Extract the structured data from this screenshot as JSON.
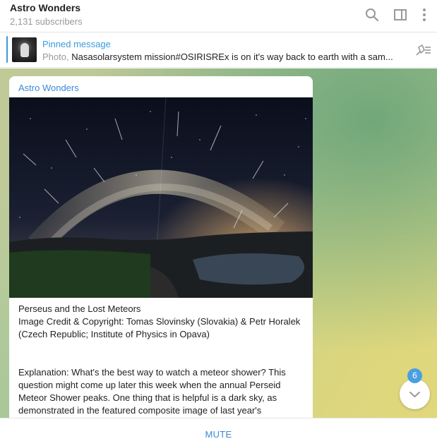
{
  "header": {
    "title": "Astro Wonders",
    "subtitle": "2,131 subscribers",
    "icons": [
      "search-icon",
      "sidebar-toggle-icon",
      "more-vertical-icon"
    ]
  },
  "pinned": {
    "label": "Pinned message",
    "type": "Photo,",
    "text": "Nasasolarsystem mission#OSIRISREx is on it's way back to earth with a sam...",
    "icons": [
      "pinned-thumbnail",
      "unpin-icon"
    ]
  },
  "message": {
    "channel": "Astro Wonders",
    "caption_lines": [
      "Perseus and the Lost Meteors",
      "Image Credit & Copyright: Tomas Slovinsky (Slovakia) & Petr Horalek (Czech Republic; Institute of Physics in Opava)"
    ],
    "explanation": "Explanation: What's the best way to watch a meteor shower? This question might come up later this week when the annual Perseid Meteor Shower peaks. One thing that is helpful is a dark sky, as demonstrated in the featured composite image of last year's"
  },
  "unread_count": "6",
  "footer": {
    "mute_label": "MUTE"
  },
  "colors": {
    "accent": "#3a8ad8",
    "badge": "#4a9fe0"
  }
}
